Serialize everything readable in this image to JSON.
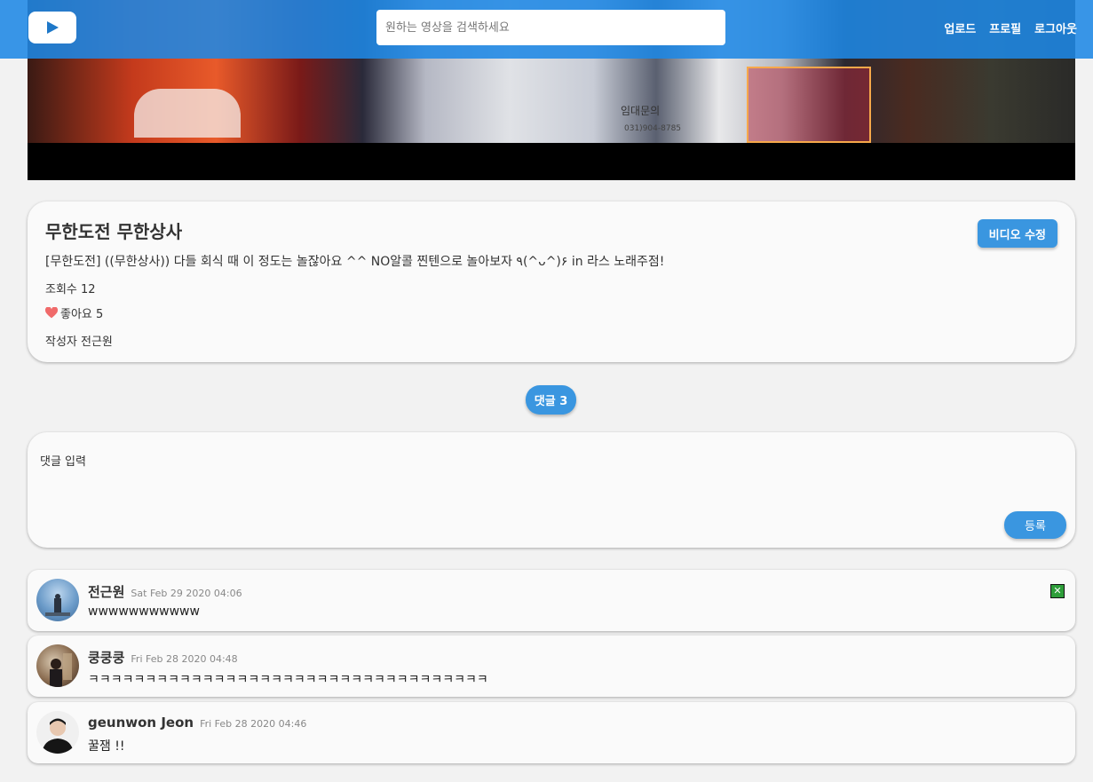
{
  "header": {
    "search_placeholder": "원하는 영상을 검색하세요",
    "nav": {
      "upload": "업로드",
      "profile": "프로필",
      "logout": "로그아웃"
    }
  },
  "video": {
    "sign_text": "임대문의",
    "sign_phone": "031)904-8785"
  },
  "info": {
    "title": "무한도전 무한상사",
    "edit_button": "비디오 수정",
    "description": "[무한도전] ((무한상사)) 다들 회식 때 이 정도는 놀잖아요 ^^ NO알콜 찐텐으로 놀아보자 ٩(^ᴗ^)۶ in 라스 노래주점!",
    "views": "조회수 12",
    "likes": "좋아요 5",
    "author": "작성자 전근원"
  },
  "comments_section": {
    "count_label": "댓글 3",
    "input_placeholder": "댓글 입력",
    "submit_label": "등록"
  },
  "comments": [
    {
      "name": "전근원",
      "date": "Sat Feb 29 2020 04:06",
      "body": "wwwwwwwwwww"
    },
    {
      "name": "쿵쿵쿵",
      "date": "Fri Feb 28 2020 04:48",
      "body": "ㅋㅋㅋㅋㅋㅋㅋㅋㅋㅋㅋㅋㅋㅋㅋㅋㅋㅋㅋㅋㅋㅋㅋㅋㅋㅋㅋㅋㅋㅋㅋㅋㅋㅋㅋ"
    },
    {
      "name": "geunwon Jeon",
      "date": "Fri Feb 28 2020 04:46",
      "body": "꿀잼 !!"
    }
  ],
  "colors": {
    "header": "#1e88e5",
    "accent": "#3a96e0",
    "heart": "#f06a6a",
    "delete": "#2e9e3a"
  }
}
